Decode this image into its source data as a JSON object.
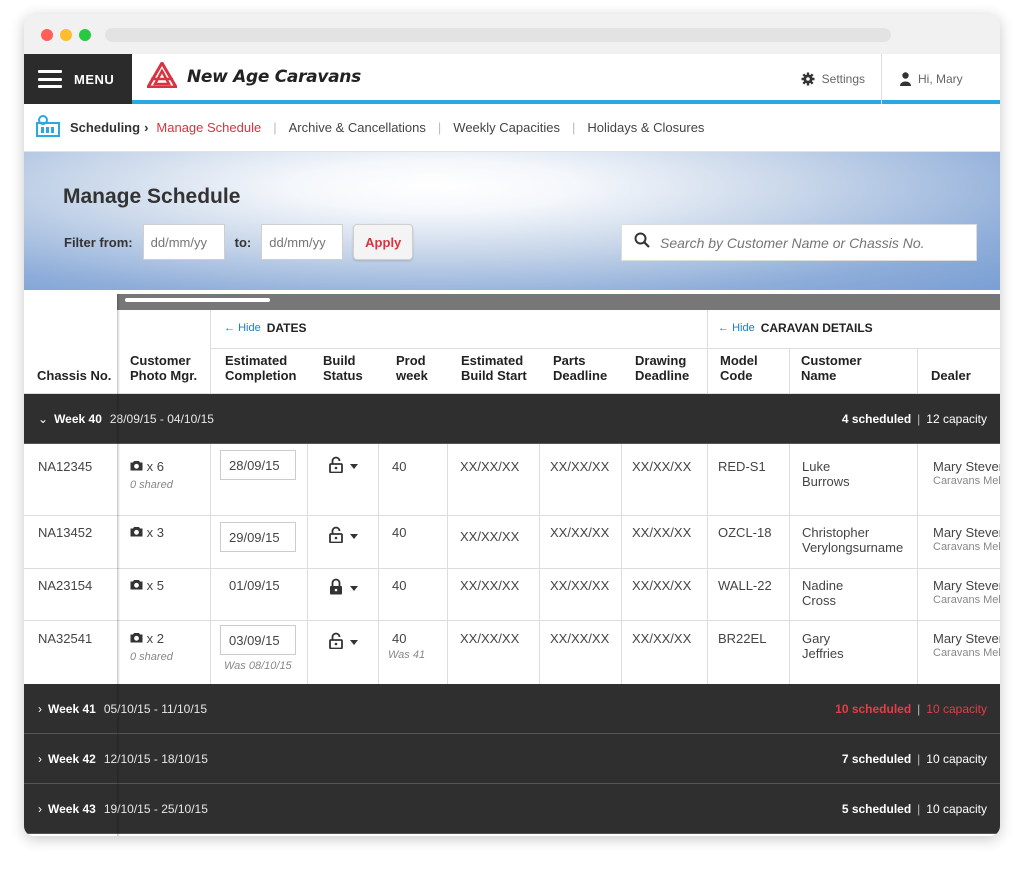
{
  "nav": {
    "menu_label": "MENU",
    "brand": "New Age Caravans",
    "settings": "Settings",
    "user": "Hi, Mary"
  },
  "breadcrumb": {
    "section": "Scheduling",
    "links": [
      "Manage Schedule",
      "Archive & Cancellations",
      "Weekly Capacities",
      "Holidays & Closures"
    ],
    "active": "Manage Schedule"
  },
  "page": {
    "title": "Manage Schedule",
    "filter_from_label": "Filter from:",
    "filter_to_label": "to:",
    "date_placeholder": "dd/mm/yy",
    "apply_label": "Apply",
    "search_placeholder": "Search by Customer Name or Chassis No."
  },
  "groups": {
    "hide": "Hide",
    "dates": "DATES",
    "caravan": "CARAVAN DETAILS"
  },
  "columns": [
    "Chassis No.",
    "Customer Photo Mgr.",
    "Estimated Completion",
    "Build Status",
    "Prod week",
    "Estimated Build Start",
    "Parts Deadline",
    "Drawing Deadline",
    "Model Code",
    "Customer Name",
    "Dealer"
  ],
  "weeks": [
    {
      "label": "Week 40",
      "range": "28/09/15 - 04/10/15",
      "scheduled": "4 scheduled",
      "capacity": "12 capacity",
      "over": false,
      "expanded": true
    },
    {
      "label": "Week 41",
      "range": "05/10/15 - 11/10/15",
      "scheduled": "10 scheduled",
      "capacity": "10 capacity",
      "over": true,
      "expanded": false
    },
    {
      "label": "Week 42",
      "range": "12/10/15 - 18/10/15",
      "scheduled": "7 scheduled",
      "capacity": "10 capacity",
      "over": false,
      "expanded": false
    },
    {
      "label": "Week 43",
      "range": "19/10/15 - 25/10/15",
      "scheduled": "5 scheduled",
      "capacity": "10 capacity",
      "over": false,
      "expanded": false
    }
  ],
  "rows": [
    {
      "chassis": "NA12345",
      "photos": "x 6",
      "shared": "0 shared",
      "completion": "28/09/15",
      "completion_boxed": true,
      "was_date": "",
      "lock": "unlocked",
      "prod_week": "40",
      "was_week": "",
      "build_start": "XX/XX/XX",
      "parts": "XX/XX/XX",
      "drawing": "XX/XX/XX",
      "model": "RED-S1",
      "customer_1": "Luke",
      "customer_2": "Burrows",
      "dealer": "Mary Stevens",
      "dealer_sub": "Caravans Melbourne"
    },
    {
      "chassis": "NA13452",
      "photos": "x 3",
      "shared": "",
      "completion": "29/09/15",
      "completion_boxed": true,
      "was_date": "",
      "lock": "unlocked",
      "prod_week": "40",
      "was_week": "",
      "build_start": "XX/XX/XX",
      "parts": "XX/XX/XX",
      "drawing": "XX/XX/XX",
      "model": "OZCL-18",
      "customer_1": "Christopher",
      "customer_2": "Verylongsurname",
      "dealer": "Mary Stevens",
      "dealer_sub": "Caravans Melbourne"
    },
    {
      "chassis": "NA23154",
      "photos": "x 5",
      "shared": "",
      "completion": "01/09/15",
      "completion_boxed": false,
      "was_date": "",
      "lock": "locked",
      "prod_week": "40",
      "was_week": "",
      "build_start": "XX/XX/XX",
      "parts": "XX/XX/XX",
      "drawing": "XX/XX/XX",
      "model": "WALL-22",
      "customer_1": "Nadine",
      "customer_2": "Cross",
      "dealer": "Mary Stevens",
      "dealer_sub": "Caravans Melbourne"
    },
    {
      "chassis": "NA32541",
      "photos": "x 2",
      "shared": "0 shared",
      "completion": "03/09/15",
      "completion_boxed": true,
      "was_date": "Was 08/10/15",
      "lock": "unlocked",
      "prod_week": "40",
      "was_week": "Was 41",
      "build_start": "XX/XX/XX",
      "parts": "XX/XX/XX",
      "drawing": "XX/XX/XX",
      "model": "BR22EL",
      "customer_1": "Gary",
      "customer_2": "Jeffries",
      "dealer": "Mary Stevens",
      "dealer_sub": "Caravans Melbourne"
    }
  ],
  "colors": {
    "accent_red": "#d9333f",
    "accent_blue": "#29a9e0",
    "dark": "#2f2f2f"
  }
}
